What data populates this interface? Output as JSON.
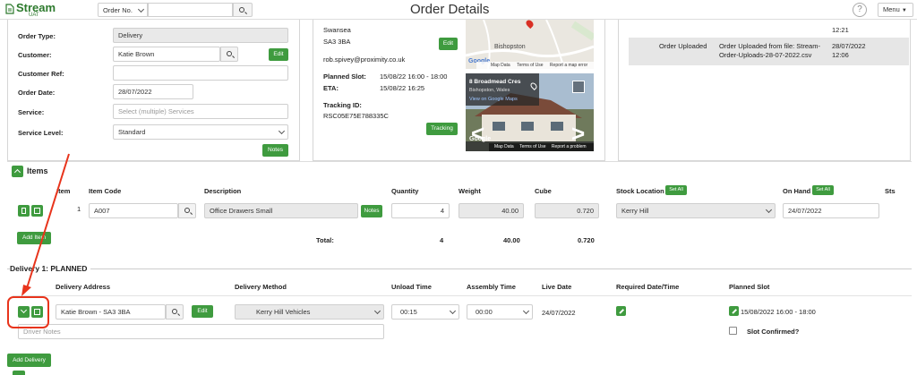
{
  "header": {
    "logo_text": "Stream",
    "logo_sub": "UAT",
    "order_select": "Order No.",
    "page_title": "Order Details",
    "help": "?",
    "menu": "Menu"
  },
  "order_form": {
    "order_type_label": "Order Type:",
    "order_type": "Delivery",
    "customer_label": "Customer:",
    "customer": "Katie Brown",
    "customer_edit": "Edit",
    "customer_ref_label": "Customer Ref:",
    "order_date_label": "Order Date:",
    "order_date": "28/07/2022",
    "service_label": "Service:",
    "service_placeholder": "Select (multiple) Services",
    "service_level_label": "Service Level:",
    "service_level": "Standard",
    "notes_btn": "Notes"
  },
  "delivery_info": {
    "town": "Swansea",
    "postcode": "SA3 3BA",
    "edit_btn": "Edit",
    "email": "rob.spivey@proximity.co.uk",
    "planned_slot_label": "Planned Slot:",
    "planned_slot": "15/08/22 16:00 - 18:00",
    "eta_label": "ETA:",
    "eta": "15/08/22 16:25",
    "tracking_label": "Tracking ID:",
    "tracking_id": "RSC05E75E788335C",
    "tracking_btn": "Tracking"
  },
  "map": {
    "place": "Bishopston",
    "google": "Google",
    "map_data": "Map Data",
    "terms": "Terms of Use",
    "report": "Report a map error"
  },
  "streetview": {
    "title": "8 Broadmead Cres",
    "subtitle": "Bishopston, Wales",
    "link": "View on Google Maps",
    "google": "Google",
    "map_data": "Map Data",
    "terms": "Terms of Use",
    "report": "Report a problem"
  },
  "history": {
    "time1": "12:21",
    "event": "Order Uploaded",
    "detail": "Order Uploaded from file: Stream-Order-Uploads-28-07-2022.csv",
    "date2": "28/07/2022",
    "time2": "12:06"
  },
  "items": {
    "title": "Items",
    "headers": {
      "item": "Item",
      "code": "Item Code",
      "description": "Description",
      "quantity": "Quantity",
      "weight": "Weight",
      "cube": "Cube",
      "stock_location": "Stock Location",
      "set_all": "Set All",
      "on_hand": "On Hand",
      "sts": "Sts"
    },
    "row": {
      "num": "1",
      "code": "A007",
      "description": "Office Drawers Small",
      "notes": "Notes",
      "quantity": "4",
      "weight": "40.00",
      "cube": "0.720",
      "stock_location": "Kerry Hill",
      "on_hand": "24/07/2022"
    },
    "add_item": "Add Item",
    "total_label": "Total:",
    "total_quantity": "4",
    "total_weight": "40.00",
    "total_cube": "0.720"
  },
  "delivery1": {
    "title": "Delivery 1: PLANNED",
    "headers": {
      "address": "Delivery Address",
      "method": "Delivery Method",
      "unload": "Unload Time",
      "assembly": "Assembly Time",
      "live": "Live Date",
      "required": "Required Date/Time",
      "planned": "Planned Slot"
    },
    "address": "Katie Brown - SA3 3BA",
    "edit": "Edit",
    "method": "Kerry Hill Vehicles",
    "unload": "00:15",
    "assembly": "00:00",
    "live_date": "24/07/2022",
    "planned_slot": "15/08/2022 16:00 - 18:00",
    "driver_notes_placeholder": "Driver Notes",
    "slot_confirmed": "Slot Confirmed?"
  },
  "add_delivery": "Add Delivery",
  "colors": {
    "green": "#3f9b3f",
    "annotation_red": "#e8341c"
  }
}
